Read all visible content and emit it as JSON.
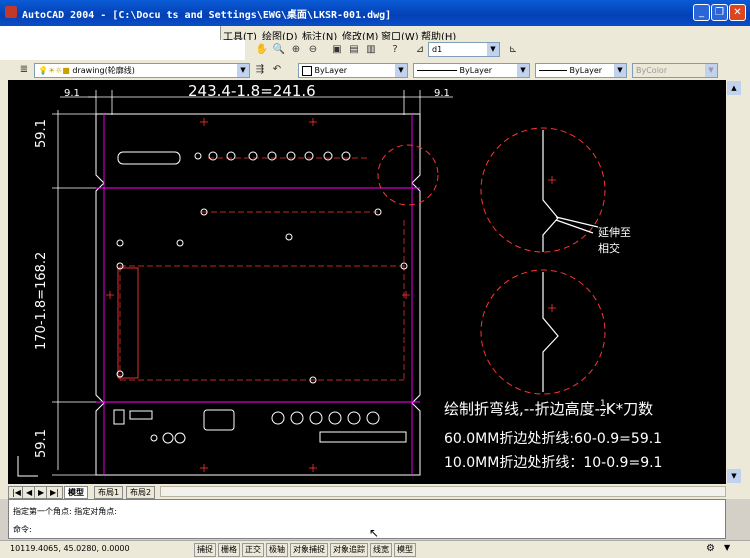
{
  "window": {
    "title": "AutoCAD 2004 - [C:\\Docu  ts and Settings\\EWG\\桌面\\LKSR-001.dwg]",
    "minimize": "_",
    "restore": "❐",
    "close": "✕"
  },
  "menu": [
    "工具(T)",
    "绘图(D)",
    "标注(N)",
    "修改(M)",
    "窗口(W)",
    "帮助(H)"
  ],
  "toolbar": {
    "dimstyle_value": "d1",
    "layer_value": "drawing(轮廓线)",
    "color_value": "ByLayer",
    "linetype_value": "ByLayer",
    "lineweight_value": "ByLayer",
    "plotstyle_value": "ByColor"
  },
  "drawing": {
    "dim_top_left": "9.1",
    "dim_top_main": "243.4-1.8=241.6",
    "dim_top_right": "9.1",
    "dim_left_top": "59.1",
    "dim_left_mid": "170-1.8=168.2",
    "dim_left_bottom": "59.1",
    "callout_line1": "延伸至",
    "callout_line2": "相交",
    "note_line1_a": "绘制折弯线,--折边高度-",
    "note_fraction_num": "1",
    "note_fraction_den": "2",
    "note_line1_b": "K*刀数",
    "note_line2": "60.0MM折边处折线:60-0.9=59.1",
    "note_line3": "10.0MM折边处折线：10-0.9=9.1"
  },
  "layout_tabs": [
    "模型",
    "布局1",
    "布局2"
  ],
  "command": {
    "history": "指定第一个角点: 指定对角点:",
    "prompt": "命令:"
  },
  "status": {
    "coords": "10119.4065, 45.0280, 0.0000",
    "buttons": [
      "捕捉",
      "栅格",
      "正交",
      "极轴",
      "对象捕捉",
      "对象追踪",
      "线宽",
      "模型"
    ]
  }
}
